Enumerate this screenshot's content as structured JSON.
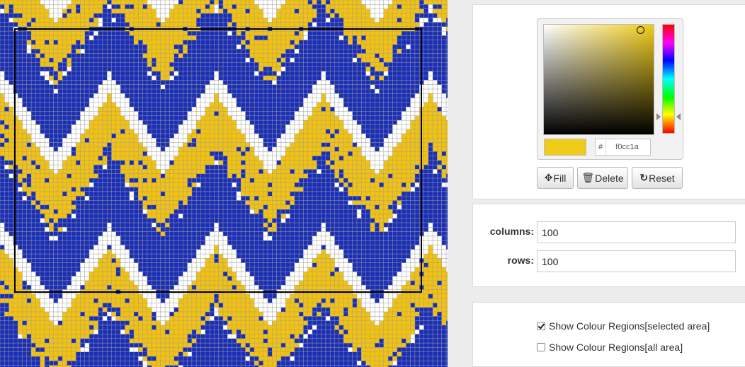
{
  "canvas": {
    "columns": 100,
    "rows": 100
  },
  "palette": {
    "blue": "#1a2fb5",
    "yellow": "#f2c20e",
    "white": "#ffffff",
    "outline": "#000000",
    "gridline": "#9a9a9a"
  },
  "picker": {
    "hex_prefix": "#",
    "hex_value": "f0cc1a",
    "current_color": "#f0cc1a"
  },
  "buttons": {
    "fill": "Fill",
    "delete": "Delete",
    "reset": "Reset"
  },
  "icons": {
    "fill": "move-arrows-icon",
    "delete": "trash-icon",
    "reset": "reset-icon"
  },
  "fields": {
    "columns_label": "columns:",
    "columns_value": "100",
    "rows_label": "rows:",
    "rows_value": "100"
  },
  "regions": {
    "selected_label": "Show Colour Regions[selected area]",
    "selected_checked": true,
    "all_label": "Show Colour Regions[all area]",
    "all_checked": false
  }
}
